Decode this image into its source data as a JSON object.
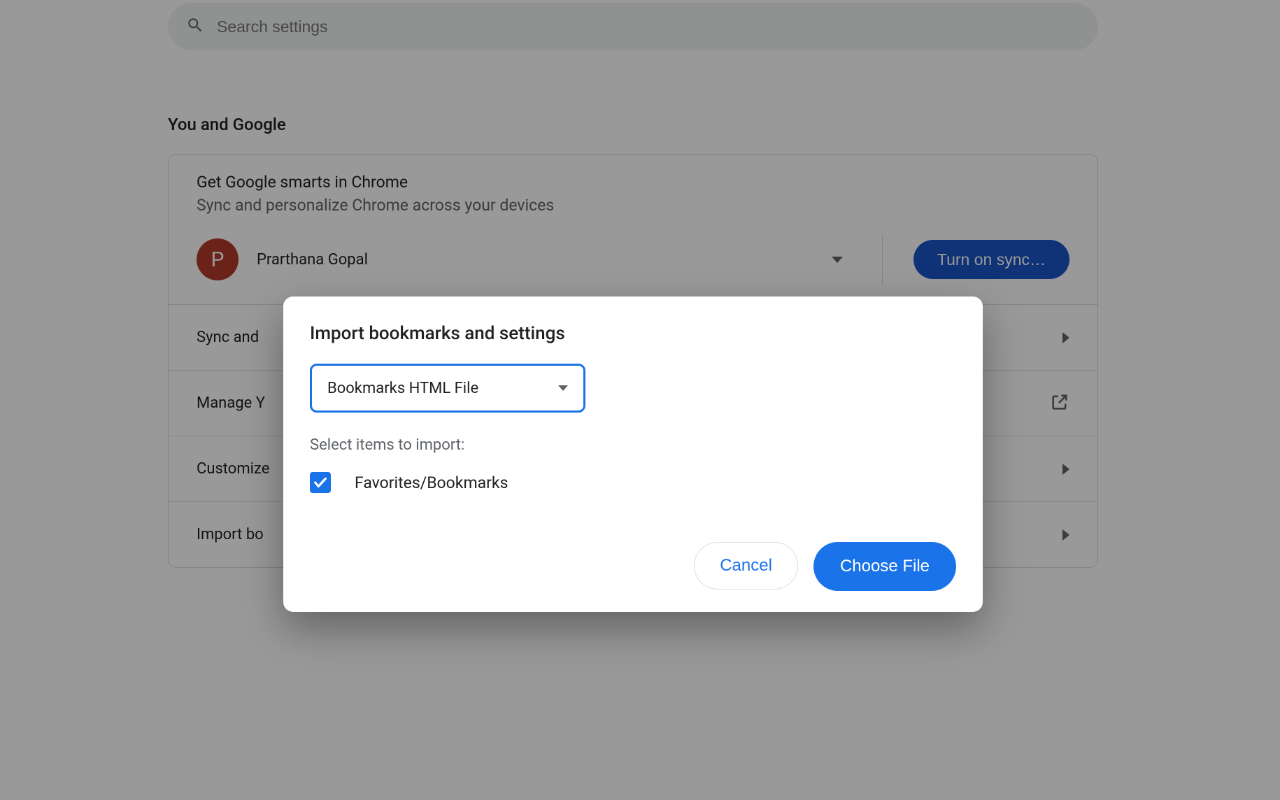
{
  "search": {
    "placeholder": "Search settings"
  },
  "section_title": "You and Google",
  "promo": {
    "title": "Get Google smarts in Chrome",
    "subtitle": "Sync and personalize Chrome across your devices"
  },
  "account": {
    "initial": "P",
    "name": "Prarthana Gopal",
    "sync_button": "Turn on sync…"
  },
  "rows": {
    "sync": "Sync and",
    "manage": "Manage Y",
    "customize": "Customize",
    "import": "Import bo"
  },
  "dialog": {
    "title": "Import bookmarks and settings",
    "select_value": "Bookmarks HTML File",
    "items_label": "Select items to import:",
    "checkbox_label": "Favorites/Bookmarks",
    "cancel": "Cancel",
    "confirm": "Choose File"
  }
}
